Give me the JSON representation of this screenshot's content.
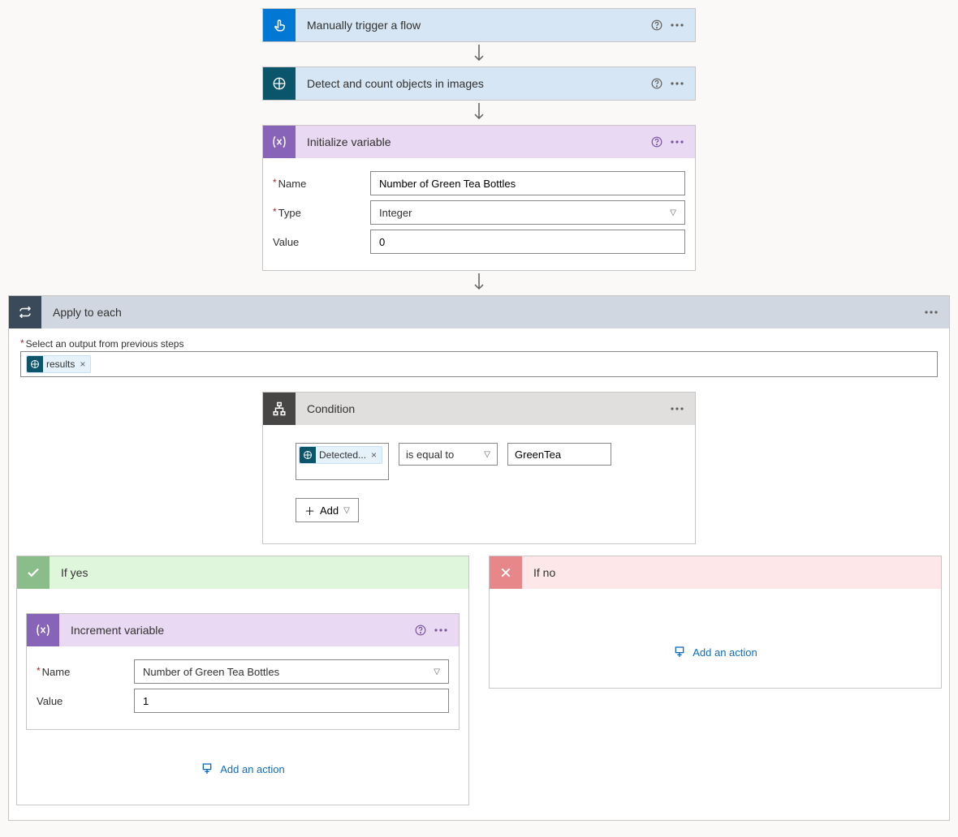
{
  "trigger": {
    "title": "Manually trigger a flow"
  },
  "detect": {
    "title": "Detect and count objects in images"
  },
  "initVar": {
    "title": "Initialize variable",
    "labels": {
      "name": "Name",
      "type": "Type",
      "value": "Value"
    },
    "name": "Number of Green Tea Bottles",
    "type": "Integer",
    "value": "0"
  },
  "applyEach": {
    "title": "Apply to each",
    "outputLabel": "Select an output from previous steps",
    "token": "results"
  },
  "condition": {
    "title": "Condition",
    "lhsToken": "Detected...",
    "operator": "is equal to",
    "rhs": "GreenTea",
    "addBtn": "Add"
  },
  "ifYes": {
    "title": "If yes"
  },
  "ifNo": {
    "title": "If no"
  },
  "incVar": {
    "title": "Increment variable",
    "labels": {
      "name": "Name",
      "value": "Value"
    },
    "name": "Number of Green Tea Bottles",
    "value": "1"
  },
  "common": {
    "addAction": "Add an action"
  }
}
